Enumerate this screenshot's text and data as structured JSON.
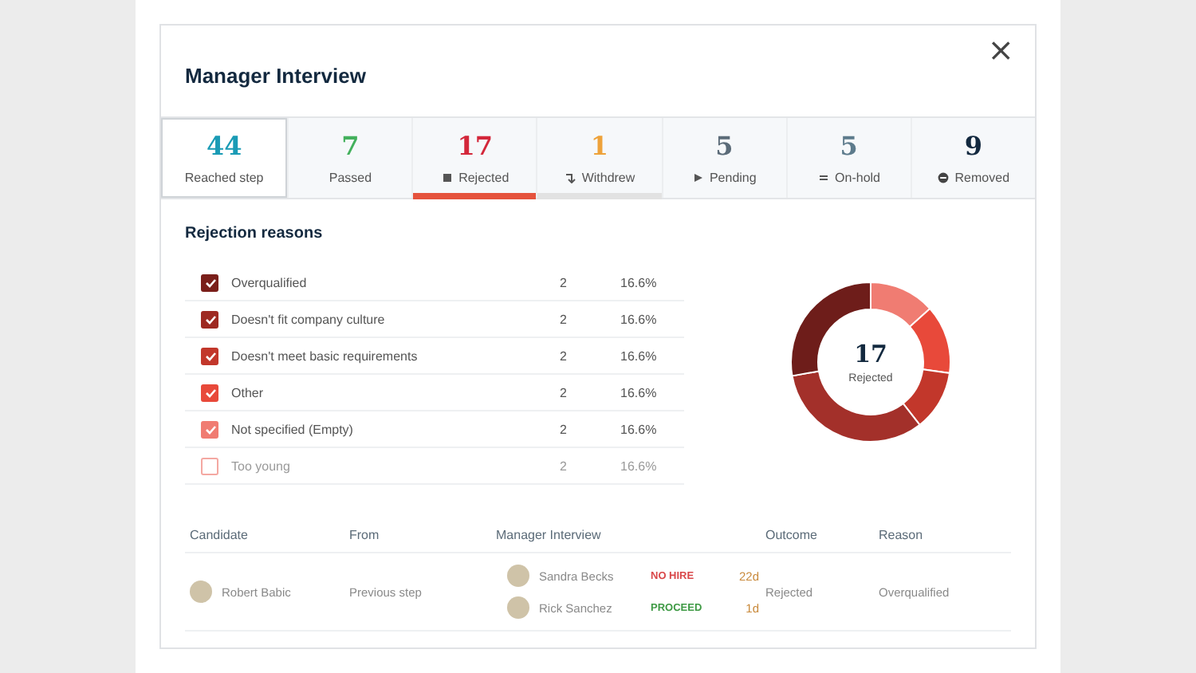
{
  "dialog": {
    "title": "Manager Interview",
    "close": "×"
  },
  "tabs": [
    {
      "kind": "reached",
      "count": "44",
      "label": "Reached step",
      "color": "#1a9bb5",
      "selected": true
    },
    {
      "kind": "passed",
      "count": "7",
      "label": "Passed",
      "color": "#43b05c",
      "selected": false
    },
    {
      "kind": "rejected",
      "count": "17",
      "label": "Rejected",
      "color": "#d3273a",
      "selected": false,
      "underline": {
        "color": "#e5533d"
      }
    },
    {
      "kind": "withdrew",
      "count": "1",
      "label": "Withdrew",
      "color": "#eea23a",
      "selected": false,
      "underline": {
        "color": "#e2e2e2"
      }
    },
    {
      "kind": "pending",
      "count": "5",
      "label": "Pending",
      "color": "#5b6b78",
      "selected": false
    },
    {
      "kind": "onhold",
      "count": "5",
      "label": "On-hold",
      "color": "#5d7b8c",
      "selected": false
    },
    {
      "kind": "removed",
      "count": "9",
      "label": "Removed",
      "color": "#13293f",
      "selected": false
    }
  ],
  "rejection_reasons": {
    "title": "Rejection reasons",
    "items": [
      {
        "label": "Overqualified",
        "count": "2",
        "percent": "16.6%",
        "checked": true,
        "color": "#7a1f1a"
      },
      {
        "label": "Doesn't fit company culture",
        "count": "2",
        "percent": "16.6%",
        "checked": true,
        "color": "#9e2a22"
      },
      {
        "label": "Doesn't meet basic requirements",
        "count": "2",
        "percent": "16.6%",
        "checked": true,
        "color": "#c2372b"
      },
      {
        "label": "Other",
        "count": "2",
        "percent": "16.6%",
        "checked": true,
        "color": "#e8493a"
      },
      {
        "label": "Not specified (Empty)",
        "count": "2",
        "percent": "16.6%",
        "checked": true,
        "color": "#f07c72"
      },
      {
        "label": "Too young",
        "count": "2",
        "percent": "16.6%",
        "checked": false,
        "color": "#f4a8a2"
      }
    ],
    "donut": {
      "count": "17",
      "label": "Rejected"
    }
  },
  "table": {
    "columns": [
      "Candidate",
      "From",
      "Manager Interview",
      "Outcome",
      "Reason"
    ],
    "rows": [
      {
        "candidate": "Robert Babic",
        "from": "Previous step",
        "interviews": [
          {
            "name": "Sandra Becks",
            "verdict": "NO HIRE",
            "kind": "nohire",
            "time": "22d"
          },
          {
            "name": "Rick Sanchez",
            "verdict": "PROCEED",
            "kind": "proceed",
            "time": "1d"
          }
        ],
        "outcome": "Rejected",
        "reason": "Overqualified"
      }
    ]
  }
}
